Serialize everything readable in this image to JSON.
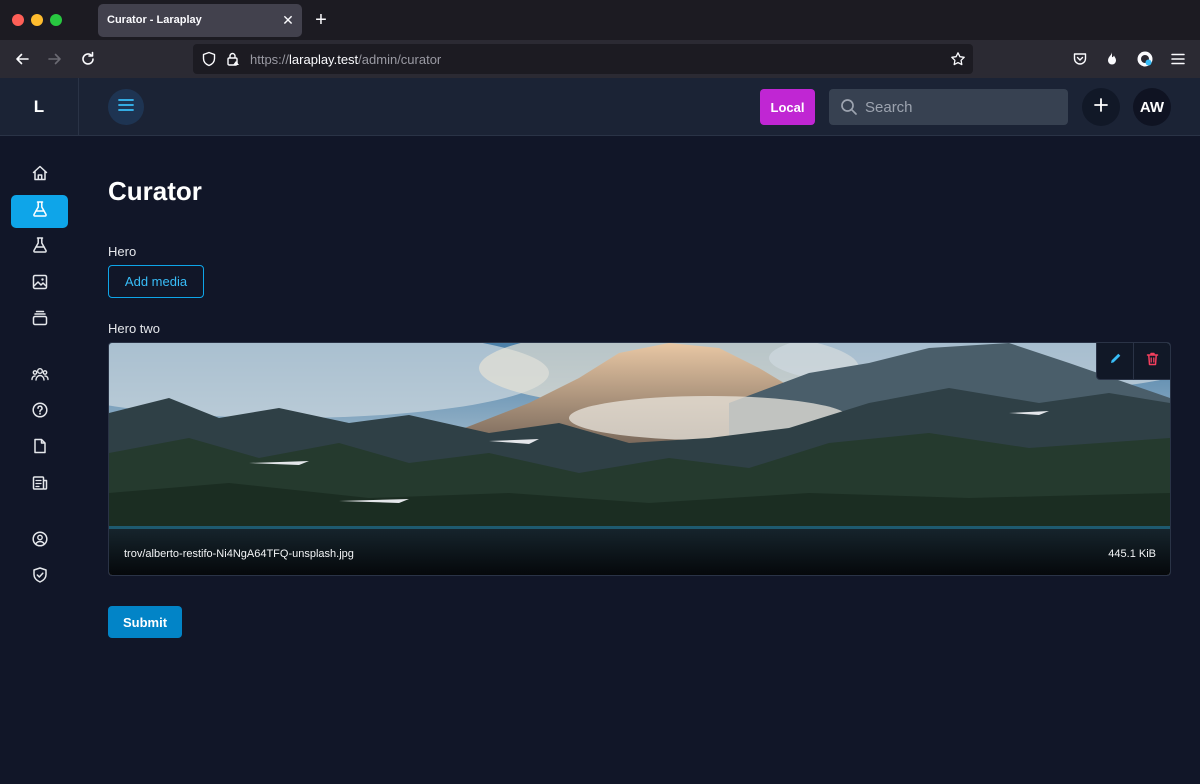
{
  "browser": {
    "tab_title": "Curator - Laraplay",
    "url_scheme": "https://",
    "url_host": "laraplay.test",
    "url_path": "/admin/curator"
  },
  "header": {
    "logo": "L",
    "environment_badge": "Local",
    "environment_color": "#c026d3",
    "search_placeholder": "Search",
    "avatar_initials": "AW"
  },
  "sidebar": {
    "items": [
      {
        "icon": "home-icon",
        "active": false
      },
      {
        "icon": "flask-icon",
        "active": true
      },
      {
        "icon": "flask-icon",
        "active": false
      },
      {
        "icon": "image-icon",
        "active": false
      },
      {
        "icon": "stack-icon",
        "active": false
      },
      {
        "icon": "users-icon",
        "active": false
      },
      {
        "icon": "help-circle-icon",
        "active": false
      },
      {
        "icon": "document-icon",
        "active": false
      },
      {
        "icon": "newspaper-icon",
        "active": false
      },
      {
        "icon": "user-circle-icon",
        "active": false
      },
      {
        "icon": "shield-check-icon",
        "active": false
      }
    ],
    "accent_color": "#0ea5e9"
  },
  "main": {
    "title": "Curator",
    "hero_label": "Hero",
    "add_media_label": "Add media",
    "hero_two_label": "Hero two",
    "media": {
      "filename": "trov/alberto-restifo-Ni4NgA64TFQ-unsplash.jpg",
      "size": "445.1 KiB"
    },
    "submit_label": "Submit"
  }
}
